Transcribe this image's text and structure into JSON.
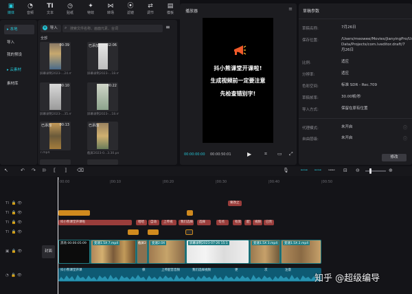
{
  "toolbar": {
    "items": [
      {
        "icon": "media-icon",
        "label": "媒体"
      },
      {
        "icon": "audio-icon",
        "label": "音频"
      },
      {
        "icon": "text-icon",
        "label": "文本"
      },
      {
        "icon": "sticker-icon",
        "label": "贴纸"
      },
      {
        "icon": "effects-icon",
        "label": "特效"
      },
      {
        "icon": "transition-icon",
        "label": "转场"
      },
      {
        "icon": "filter-icon",
        "label": "滤镜"
      },
      {
        "icon": "adjust-icon",
        "label": "调节"
      },
      {
        "icon": "template-icon",
        "label": "模板"
      }
    ]
  },
  "sidebar": {
    "items": [
      {
        "label": "▸ 本地"
      },
      {
        "label": "导入"
      },
      {
        "label": "我的预设"
      },
      {
        "label": "▸ 云素材"
      },
      {
        "label": "素材库"
      }
    ]
  },
  "media": {
    "import_label": "导入",
    "search_placeholder": "搜索文件名称、画面元素、台词",
    "all_label": "全部",
    "thumbs": [
      {
        "dur": "00:39",
        "added": "",
        "name": "屏幕录制2023-...24.mov"
      },
      {
        "dur": "02:06",
        "added": "已添加",
        "name": "屏幕录制2023-...18.mov"
      },
      {
        "dur": "00:10",
        "added": "",
        "name": "屏幕录制2023-...35.mov"
      },
      {
        "dur": "00:22",
        "added": "",
        "name": "屏幕录制2023-...18.mov"
      },
      {
        "dur": "00:13",
        "added": "已添加",
        "name": "7.mp4"
      },
      {
        "dur": "",
        "added": "已添加",
        "name": "截屏2023-0...3.30.png"
      }
    ]
  },
  "player": {
    "title": "播放器",
    "caption_lines": [
      "抖小熊课堂开课啦!",
      "生成视频前一定要注意",
      "先检查错别字!"
    ],
    "time_current": "00:00:00:00",
    "time_total": "00:00:50:01"
  },
  "draft": {
    "title": "草稿参数",
    "rows": [
      {
        "key": "草稿名称:",
        "val": "7月26日"
      },
      {
        "key": "保存位置:",
        "val": "/Users/meowee/Movies/JianyingPro/User Data/Projects/com.lveditor.draft/7月26日"
      },
      {
        "key": "比例:",
        "val": "适应"
      },
      {
        "key": "分辨率:",
        "val": "适应"
      },
      {
        "key": "色彩空间:",
        "val": "标准 SDR - Rec.709"
      },
      {
        "key": "草稿帧率:",
        "val": "30.00帧/秒"
      },
      {
        "key": "导入方式:",
        "val": "保留在原有位置"
      },
      {
        "key": "代理模式:",
        "val": "未开启"
      },
      {
        "key": "自由层级:",
        "val": "未开启"
      }
    ],
    "edit_button": "修改"
  },
  "timeline": {
    "ticks": [
      "00:00",
      "|00:10",
      "|00:20",
      "|00:30",
      "|00:40",
      "|00:50"
    ],
    "cover_label": "封面",
    "text_clips": [
      "抖小熊课堂开课啦",
      "哈哈",
      "自动",
      "上传视",
      "我们选择",
      "选择",
      "句点",
      "有资",
      "配",
      "视频",
      "已完"
    ],
    "top_clip": "要改之",
    "video_clips": [
      {
        "label": "黑场 00:00:05:09"
      },
      {
        "label": "变速1.5X 7.mp4"
      },
      {
        "label": "截屏2"
      },
      {
        "label": "变速2.0X"
      },
      {
        "label": "屏幕录制2023-07-26 15:1"
      },
      {
        "label": "变速1.5X 3.mp4"
      },
      {
        "label": "变速1.5X 2.mp4"
      }
    ],
    "audio_clips": [
      "抖小熊课堂开课",
      "保",
      "上传配音音频",
      "我们选择视频",
      "更",
      "次",
      "注意"
    ]
  },
  "watermark": "知乎 @超级编导",
  "colors": {
    "accent": "#25c7d8",
    "orange_clip": "#d08a1e",
    "red_clip": "#9a3d3b",
    "teal_clip": "#1f7f86",
    "audio": "#0e5a73"
  }
}
